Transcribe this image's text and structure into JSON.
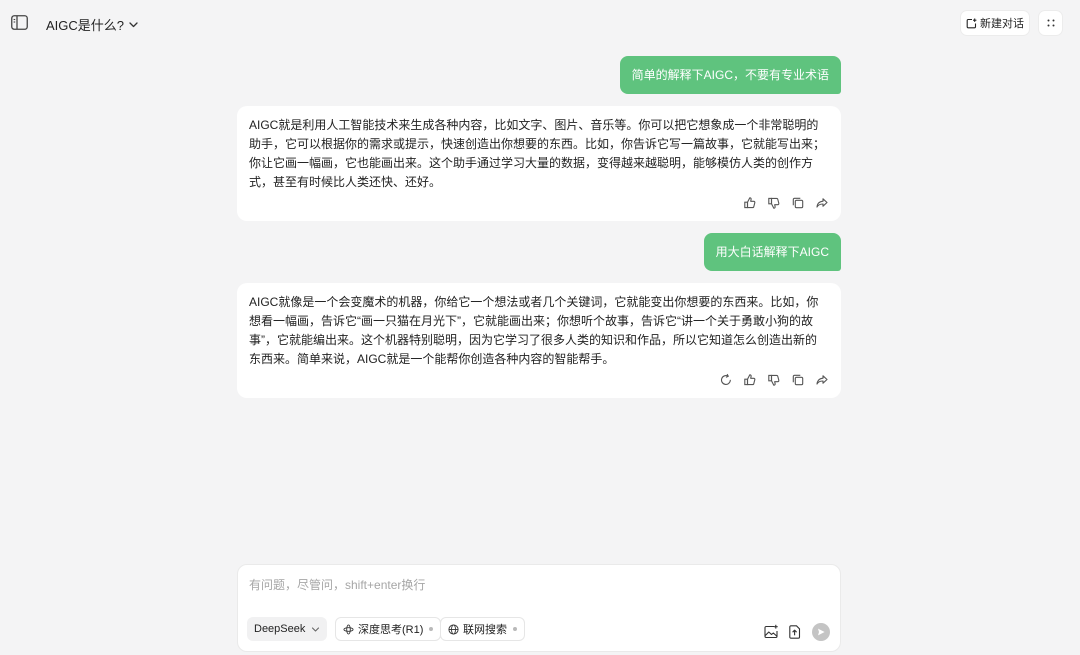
{
  "header": {
    "title": "AIGC是什么?",
    "new_chat_label": "新建对话"
  },
  "messages": [
    {
      "role": "user",
      "text": "简单的解释下AIGC，不要有专业术语"
    },
    {
      "role": "assistant",
      "text": "AIGC就是利用人工智能技术来生成各种内容，比如文字、图片、音乐等。你可以把它想象成一个非常聪明的助手，它可以根据你的需求或提示，快速创造出你想要的东西。比如，你告诉它写一篇故事，它就能写出来；你让它画一幅画，它也能画出来。这个助手通过学习大量的数据，变得越来越聪明，能够模仿人类的创作方式，甚至有时候比人类还快、还好。"
    },
    {
      "role": "user",
      "text": "用大白话解释下AIGC"
    },
    {
      "role": "assistant",
      "text": "AIGC就像是一个会变魔术的机器，你给它一个想法或者几个关键词，它就能变出你想要的东西来。比如，你想看一幅画，告诉它“画一只猫在月光下”，它就能画出来；你想听个故事，告诉它“讲一个关于勇敢小狗的故事”，它就能编出来。这个机器特别聪明，因为它学习了很多人类的知识和作品，所以它知道怎么创造出新的东西来。简单来说，AIGC就是一个能帮你创造各种内容的智能帮手。"
    }
  ],
  "composer": {
    "placeholder": "有问题，尽管问，shift+enter换行",
    "value": "",
    "model_label": "DeepSeek",
    "deep_think_label": "深度思考(R1)",
    "web_search_label": "联网搜索"
  },
  "colors": {
    "accent": "#5fc37e",
    "background": "#f4f4f5",
    "card": "#ffffff"
  }
}
